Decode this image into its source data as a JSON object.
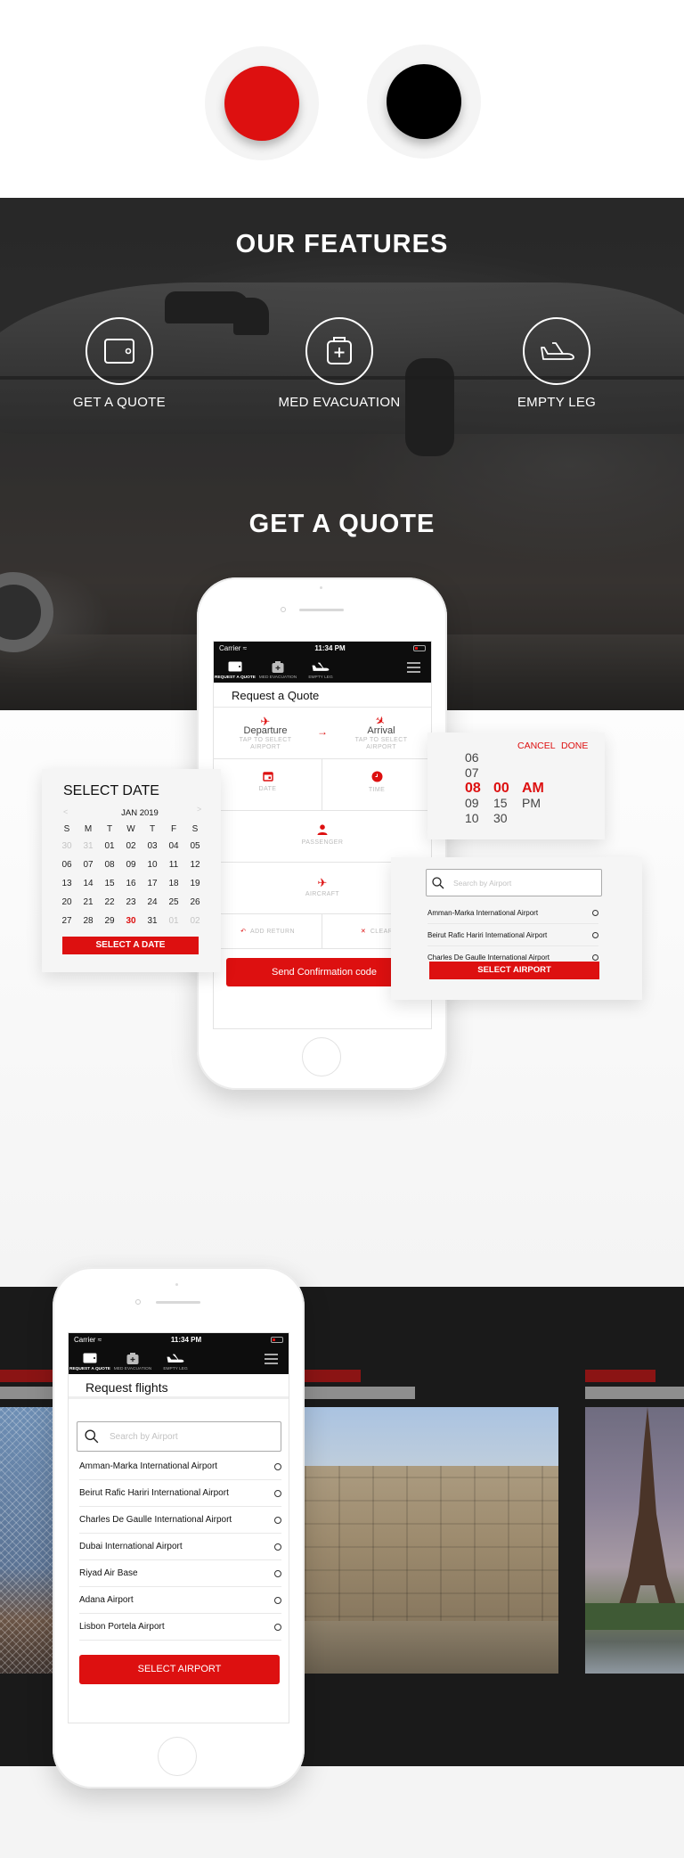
{
  "colors": {
    "accent": "#dd1010",
    "dark": "#000000",
    "band": "#1a1a1a"
  },
  "swatches": [
    {
      "name": "red",
      "color": "#dd1010"
    },
    {
      "name": "black",
      "color": "#000000"
    }
  ],
  "features": {
    "title": "OUR FEATURES",
    "items": [
      {
        "label": "GET A QUOTE",
        "icon": "wallet-icon"
      },
      {
        "label": "MED EVACUATION",
        "icon": "medical-kit-icon"
      },
      {
        "label": "EMPTY LEG",
        "icon": "airplane-icon"
      }
    ]
  },
  "quote_section": {
    "title": "GET A QUOTE"
  },
  "phone": {
    "status": {
      "carrier": "Carrier",
      "time": "11:34 PM"
    },
    "tabs": [
      {
        "label": "REQUEST A QUOTE",
        "icon": "wallet-icon",
        "active": true
      },
      {
        "label": "MED EVACUATION",
        "icon": "medical-kit-icon",
        "active": false
      },
      {
        "label": "EMPTY LEG",
        "icon": "airplane-icon",
        "active": false
      }
    ],
    "menu_icon": "hamburger-icon"
  },
  "quote_form": {
    "title": "Request a Quote",
    "departure": {
      "label": "Departure",
      "hint": "TAP TO SELECT AIRPORT"
    },
    "arrival": {
      "label": "Arrival",
      "hint": "TAP TO SELECT AIRPORT"
    },
    "date": "DATE",
    "time": "TIME",
    "passenger": "PASSENGER",
    "aircraft": "AIRCRAFT",
    "add_return": "ADD RETURN",
    "clear": "CLEAR",
    "submit": "Send Confirmation code"
  },
  "date_picker": {
    "title": "SELECT DATE",
    "month": "JAN 2019",
    "prev": "<",
    "next": ">",
    "weekdays": [
      "S",
      "M",
      "T",
      "W",
      "T",
      "F",
      "S"
    ],
    "days": [
      [
        "30",
        "31",
        "01",
        "02",
        "03",
        "04",
        "05"
      ],
      [
        "06",
        "07",
        "08",
        "09",
        "10",
        "11",
        "12"
      ],
      [
        "13",
        "14",
        "15",
        "16",
        "17",
        "18",
        "19"
      ],
      [
        "20",
        "21",
        "22",
        "23",
        "24",
        "25",
        "26"
      ],
      [
        "27",
        "28",
        "29",
        "30",
        "31",
        "01",
        "02"
      ]
    ],
    "selected": "30",
    "button": "SELECT A DATE"
  },
  "time_picker": {
    "cancel": "CANCEL",
    "done": "DONE",
    "hours": [
      "06",
      "07",
      "08",
      "09",
      "10"
    ],
    "minutes": [
      "00",
      "15",
      "30"
    ],
    "periods": [
      "AM",
      "PM"
    ],
    "selected": {
      "hour": "08",
      "minute": "00",
      "period": "AM"
    }
  },
  "airport_picker": {
    "search_placeholder": "Search by Airport",
    "airports": [
      "Amman-Marka International Airport",
      "Beirut Rafic Hariri International Airport",
      "Charles De Gaulle International Airport"
    ],
    "button": "SELECT AIRPORT"
  },
  "flights_screen": {
    "title": "Request flights",
    "search_placeholder": "Search by Airport",
    "airports": [
      "Amman-Marka International Airport",
      "Beirut Rafic Hariri International Airport",
      "Charles De Gaulle International Airport",
      "Dubai International Airport",
      "Riyad Air Base",
      "Adana Airport",
      "Lisbon Portela Airport"
    ],
    "button": "SELECT AIRPORT"
  },
  "gallery": [
    {
      "name": "bridge-photo"
    },
    {
      "name": "ruins-photo"
    },
    {
      "name": "eiffel-tower-photo"
    }
  ]
}
